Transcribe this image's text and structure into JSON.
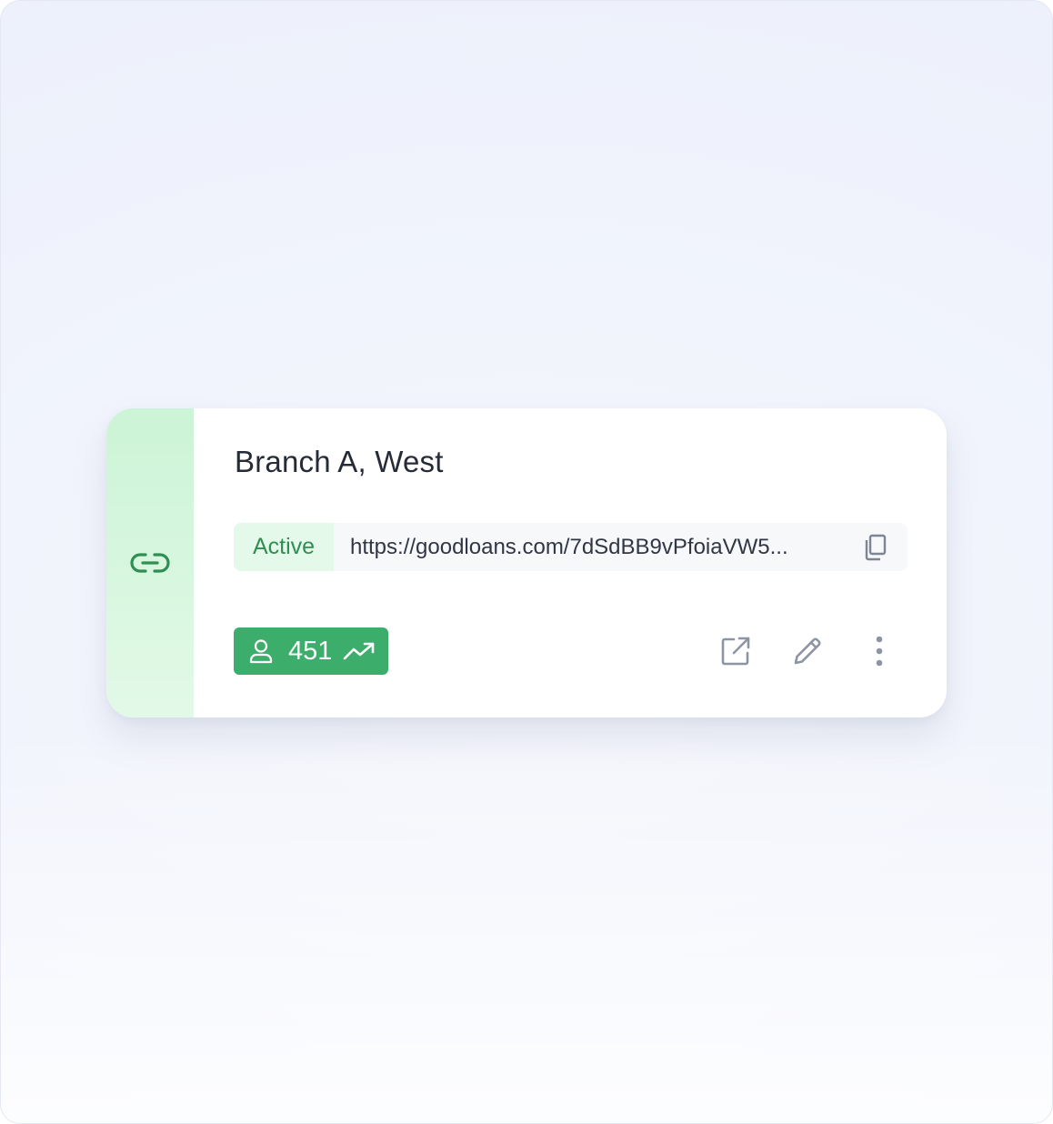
{
  "card": {
    "title": "Branch A, West",
    "status": "Active",
    "url": "https://goodloans.com/7dSdBB9vPfoiaVW5...",
    "visitors": "451"
  },
  "icons": {
    "side": "link-icon",
    "copy": "copy-icon",
    "user": "user-icon",
    "trend": "trending-up-icon",
    "open": "external-link-icon",
    "edit": "pencil-icon",
    "more": "more-vertical-icon"
  },
  "colors": {
    "accent_green": "#3dad6c",
    "status_green_text": "#2f8f53",
    "status_green_bg": "#e4f9e9",
    "side_strip_green": "#ccf4d6",
    "icon_gray": "#8d94a3",
    "title_text": "#262b38"
  }
}
